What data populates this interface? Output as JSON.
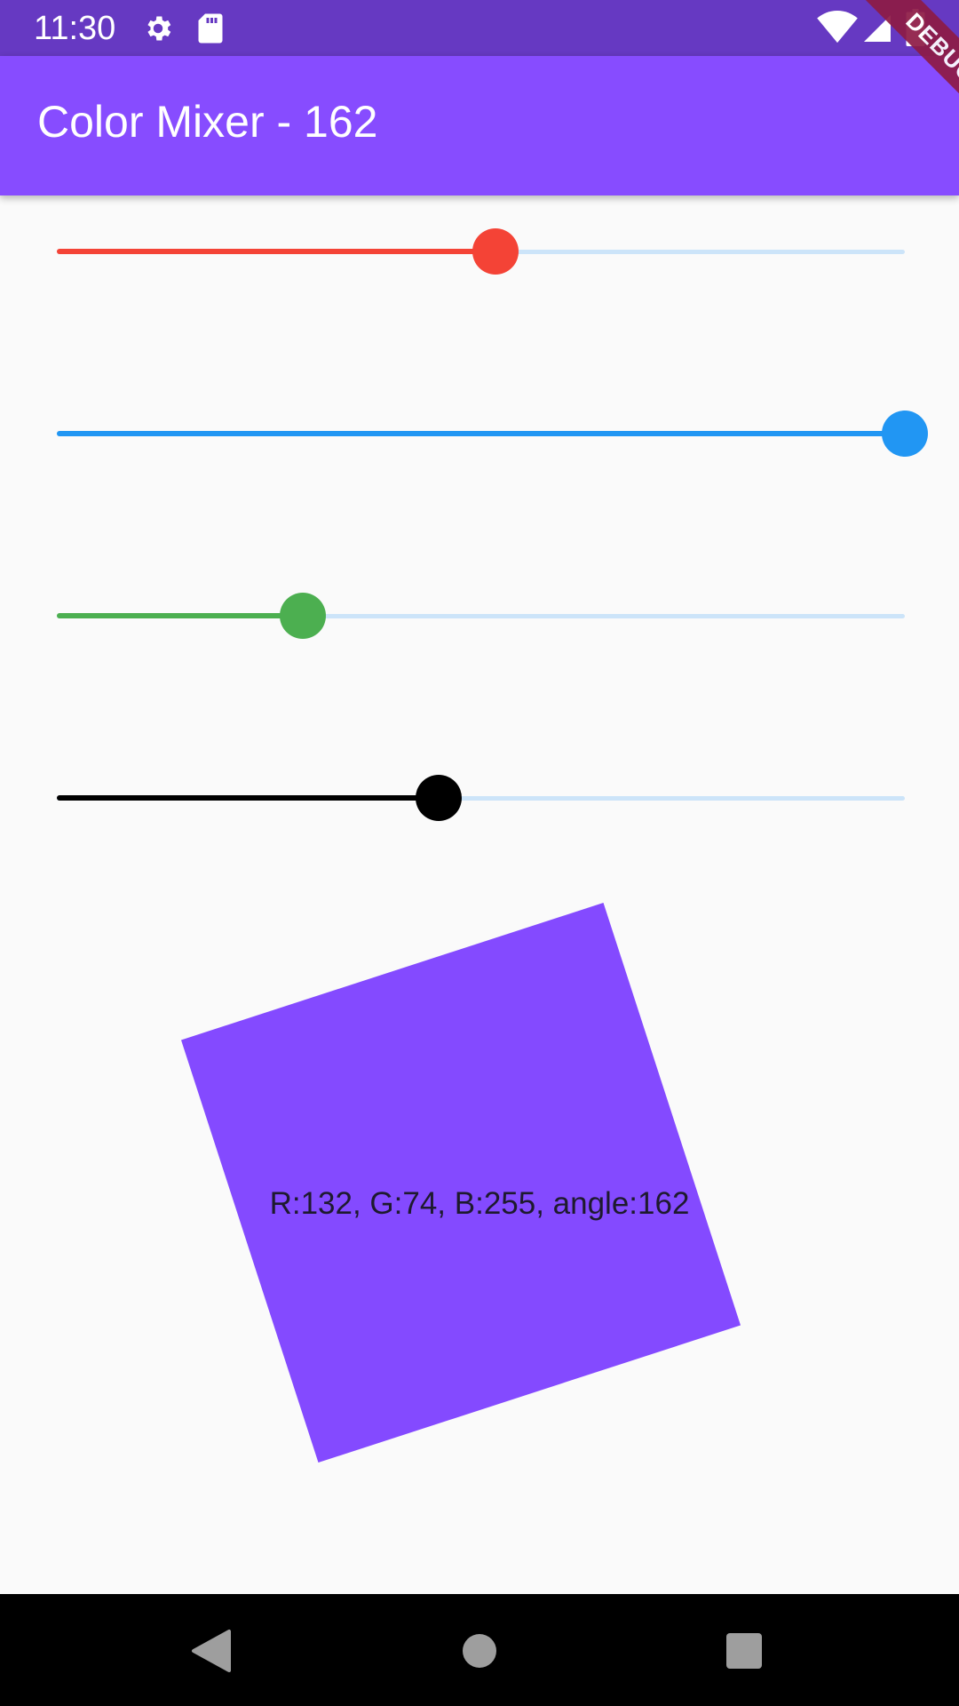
{
  "status_bar": {
    "time": "11:30",
    "icons": [
      "gear-icon",
      "sd-card-icon",
      "wifi-icon",
      "signal-icon",
      "battery-icon"
    ]
  },
  "app_bar": {
    "title": "Color Mixer - 162"
  },
  "debug_banner": {
    "label": "DEBUG"
  },
  "sliders": [
    {
      "name": "red",
      "value": 132,
      "max": 255,
      "color": "#F44336"
    },
    {
      "name": "blue",
      "value": 255,
      "max": 255,
      "color": "#2196F3"
    },
    {
      "name": "green",
      "value": 74,
      "max": 255,
      "color": "#4CAF50"
    },
    {
      "name": "angle",
      "value": 162,
      "max": 360,
      "color": "#000000"
    }
  ],
  "color_box": {
    "label": "R:132, G:74, B:255, angle:162",
    "color": "#844AFF"
  },
  "colors": {
    "status_bar": "#6639C2",
    "app_bar": "#874CFF",
    "inactive_track": "#CCE4F9",
    "background": "#FAFAFA"
  },
  "nav_bar": {
    "buttons": [
      "back-icon",
      "home-icon",
      "recents-icon"
    ]
  }
}
